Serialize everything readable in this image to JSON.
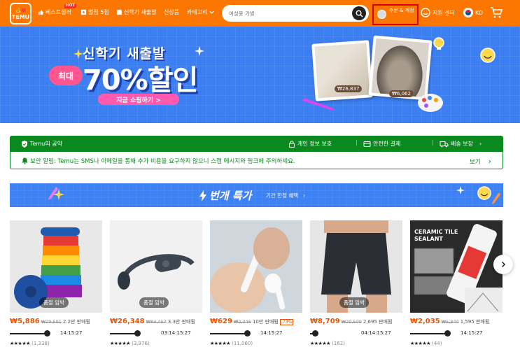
{
  "header": {
    "logo_line1": "💰❤️",
    "logo_line2": "TEMU",
    "nav": {
      "bestsellers": "베스트셀러",
      "hot_badge": "HOT",
      "five_star": "별점 5점",
      "new_arrivals_icon": "신학기 새출발",
      "new_items": "신상품",
      "categories": "카테고리"
    },
    "search_placeholder": "여성용 가방",
    "account_label": "주문 & 계정",
    "support_label": "지원 센터",
    "language": "KO",
    "brand_color": "#fb7701"
  },
  "banner": {
    "headline": "신학기 새출발",
    "max_label": "최대",
    "discount": "70%할인",
    "cta": "지금 쇼핑하기 >",
    "price_tag_1": "₩26,837",
    "price_tag_2": "₩6,062"
  },
  "promise": {
    "title": "Temu의 공약",
    "privacy": "개인 정보 보호",
    "payment": "안전한 결제",
    "delivery": "배송 보장"
  },
  "notice": {
    "text": "보안 알림: Temu는 SMS나 이메일을 통해 추가 비용을 요구하지 않으니 스캠 메시지와 링크에 주의하세요.",
    "more": "보기"
  },
  "flash": {
    "title": "번개 특가",
    "subtitle": "기간 한정 혜택"
  },
  "products": [
    {
      "badge": "품절 임박",
      "price": "₩5,886",
      "original": "₩29,591",
      "sold": "2.2만 판매됨",
      "discount": "",
      "time": "14:15:27",
      "progress": 0.82,
      "stars": "★★★★★",
      "reviews": "(1,338)"
    },
    {
      "badge": "품절 임박",
      "price": "₩26,348",
      "original": "₩83,457",
      "sold": "3.3만 판매됨",
      "discount": "",
      "time": "03:14:15:27",
      "progress": 0.6,
      "stars": "★★★★★",
      "reviews": "(3,976)"
    },
    {
      "badge": "",
      "price": "₩629",
      "original": "₩2,346",
      "sold": "10만 판매됨",
      "discount": "-73%",
      "time": "14:15:27",
      "progress": 0.82,
      "stars": "★★★★★",
      "reviews": "(11,060)"
    },
    {
      "badge": "품절 임박",
      "price": "₩8,709",
      "original": "₩29,509",
      "sold": "2,695 판매됨",
      "discount": "",
      "time": "04:14:15:27",
      "progress": 0.1,
      "stars": "★★★★★",
      "reviews": "(162)"
    },
    {
      "badge": "",
      "price": "₩2,035",
      "original": "₩5,840",
      "sold": "1,595 판매됨",
      "discount": "",
      "time": "14:15:27",
      "progress": 0.82,
      "stars": "★★★★★",
      "reviews": "(44)",
      "label": "CERAMIC TILE SEALANT"
    }
  ]
}
